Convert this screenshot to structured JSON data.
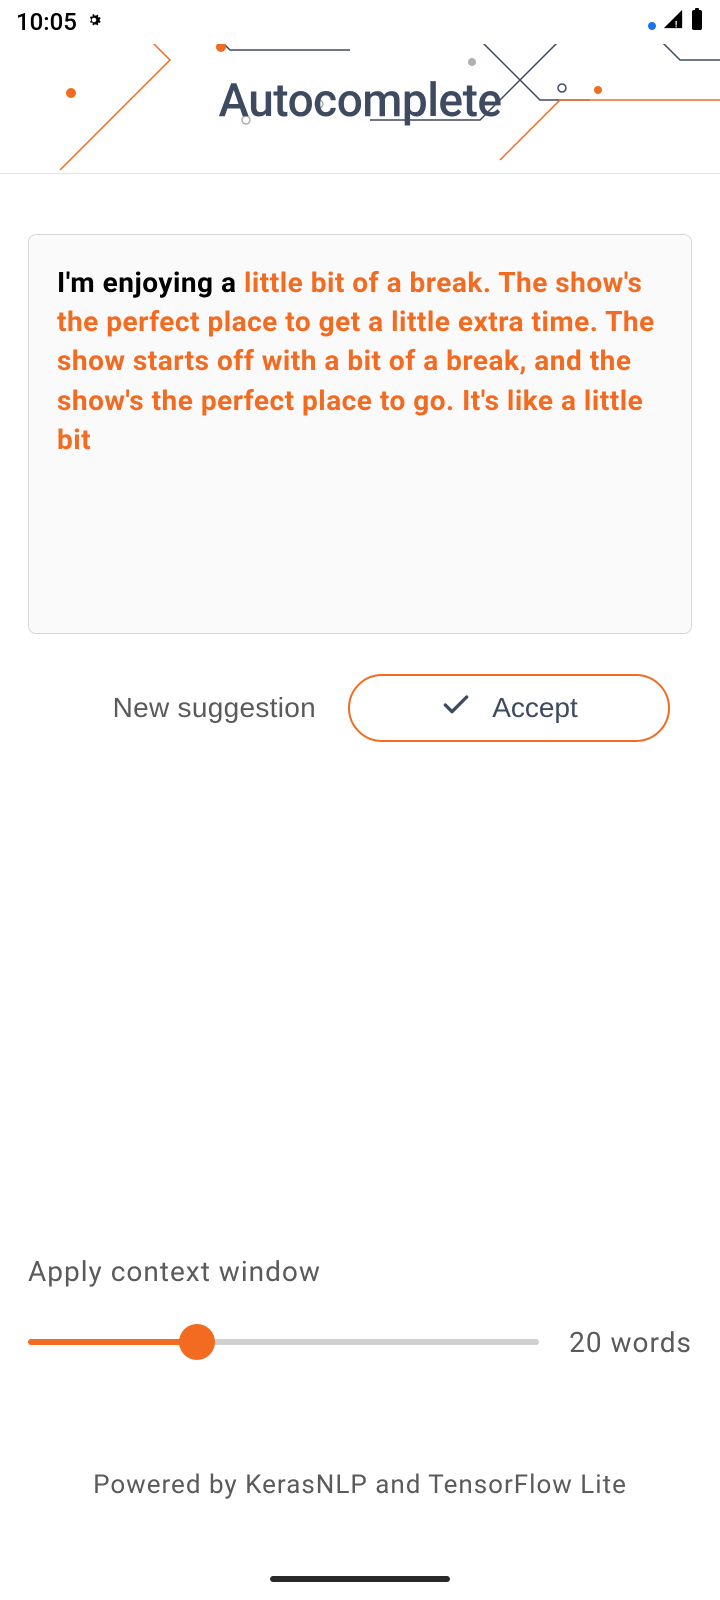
{
  "status": {
    "time": "10:05"
  },
  "header": {
    "title": "Autocomplete"
  },
  "editor": {
    "user_text": "I'm enjoying a ",
    "suggestion_text": "little bit of a break. The show's the perfect place to get a little extra time. The show starts off with a bit of a break, and the show's the perfect place to go. It's like a little bit"
  },
  "buttons": {
    "new_suggestion": "New suggestion",
    "accept": "Accept"
  },
  "slider": {
    "label": "Apply context window",
    "value_text": "20 words"
  },
  "footer": {
    "text": "Powered by KerasNLP and TensorFlow Lite"
  },
  "colors": {
    "accent": "#f26b21"
  }
}
